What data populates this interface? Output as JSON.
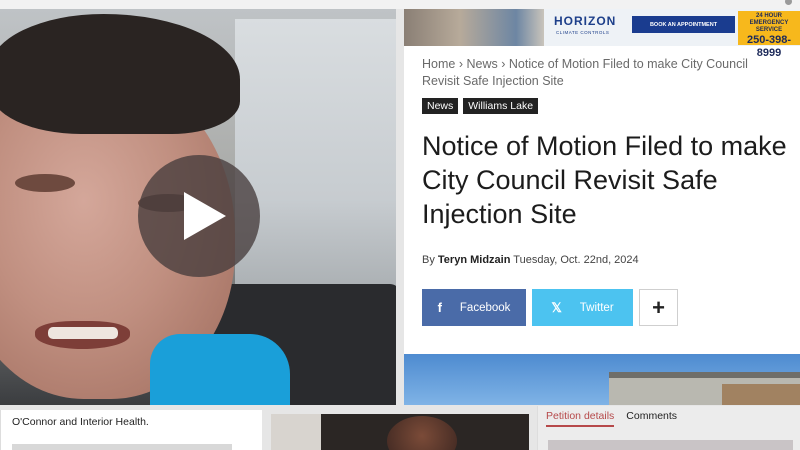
{
  "ad": {
    "logo": "HORIZON",
    "logo_sub": "CLIMATE CONTROLS",
    "book_button": "BOOK AN APPOINTMENT",
    "emergency_label": "24 HOUR EMERGENCY SERVICE",
    "phone": "250-398-8999"
  },
  "breadcrumb": {
    "home": "Home",
    "sep1": "›",
    "news": "News",
    "sep2": "›",
    "current": "Notice of Motion Filed to make City Council Revisit Safe Injection Site"
  },
  "tags": [
    "News",
    "Williams Lake"
  ],
  "article": {
    "title": "Notice of Motion Filed to make City Council Revisit Safe Injection Site",
    "by": "By",
    "author": "Teryn Midzain",
    "date": "Tuesday, Oct. 22nd, 2024"
  },
  "share": {
    "facebook_icon": "f",
    "facebook": "Facebook",
    "twitter_icon": "𝕏",
    "twitter": "Twitter",
    "more": "+"
  },
  "bottom": {
    "left_text": "O'Connor and Interior Health.",
    "tab_petition": "Petition details",
    "tab_comments": "Comments"
  }
}
